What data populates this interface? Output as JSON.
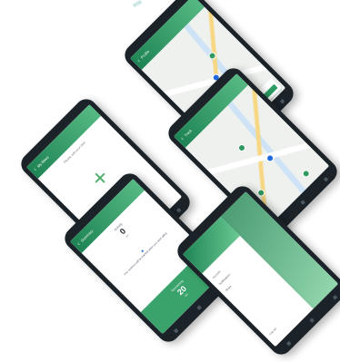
{
  "screens": {
    "map_top": {
      "title": "Profile",
      "card_button": "Confirm"
    },
    "map_right": {
      "title": "Track"
    },
    "add_screen": {
      "title": "My Bikes",
      "prompt": "Please add your bike",
      "add_glyph": "+"
    },
    "summary": {
      "title": "Summary",
      "activity_label": "Activity",
      "activity_value": "0",
      "activity_sub": "km",
      "notice_text": "Your workout will be tracked when you start riding",
      "remaining_label": "Remaining",
      "remaining_value": "20",
      "remaining_sub": "km"
    },
    "menu": {
      "items": [
        "Account",
        "Notifications",
        "Share"
      ],
      "footer_item": "Log out"
    }
  },
  "colors": {
    "accent_green": "#2c9c62",
    "map_pin_blue": "#1f6ae0",
    "phone_body": "#1b2329"
  },
  "icons": [
    "back-arrow-icon",
    "map-pin-icon",
    "plus-icon",
    "info-icon",
    "nav-back-icon",
    "nav-home-icon",
    "nav-recent-icon"
  ]
}
